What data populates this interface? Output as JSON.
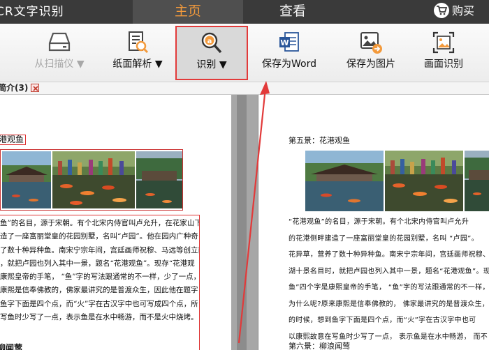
{
  "header": {
    "app_title": "CR文字识别",
    "tabs": [
      {
        "label": "主页",
        "active": true
      },
      {
        "label": "查看",
        "active": false
      }
    ],
    "buy_label": "购买",
    "accent_color": "#f39a3c"
  },
  "toolbar": {
    "scan": {
      "label": "从扫描仪 ▼",
      "icon": "scanner-icon",
      "enabled": false
    },
    "paper_analysis": {
      "label": "纸面解析 ▼",
      "icon": "document-magnify-icon"
    },
    "recognize": {
      "label": "识别 ▼",
      "icon": "ocr-magnifier-icon",
      "highlighted": true
    },
    "save_word": {
      "label": "保存为Word",
      "icon": "word-icon"
    },
    "save_image": {
      "label": "保存为图片",
      "icon": "image-export-icon"
    },
    "page_recognize": {
      "label": "画面识别",
      "icon": "screen-capture-icon"
    }
  },
  "document_tab": {
    "label": "简介(3)"
  },
  "left_page": {
    "section_title": "港观鱼",
    "lines": [
      "鱼”的名目，源于宋朝。有个北宋内侍官叫卢允升，在花家山下",
      "造了一座富丽堂皇的花园别墅，名叫“卢园”。他在园内广种奇",
      "了数十种异种鱼。南宋宁宗年间，宫廷画师祝穆、马远等创立西",
      "，就把卢园也列入其中一景，题名“花港观鱼”。现存“花港观",
      "康熙皇帝的手笔，  “鱼”字的写法跟通常的不一样，少了一点，",
      "康熙是信奉佛教的，佛家最讲究的是普渡众生，因此他在题字",
      "鱼字下面是四个点，而“火”字在古汉字中也可写成四个点，所",
      "写鱼时少写了一点，表示鱼是在水中畅游，而不是火中烧烤。"
    ],
    "next_section": "柳闻莺"
  },
  "right_page": {
    "section_title": "第五景：花港观鱼",
    "lines": [
      "“花港观鱼”的名目，源于宋朝。有个北宋内侍官叫卢允升",
      "的花港侧畔建造了一座富丽堂皇的花园别墅，名叫 “卢园”。",
      "花异草，营养了数十种异种鱼。南宋宁宗年间，宫廷画师祝穆、马",
      "湖十景名目时，就把卢园也列入其中一景，题名“花港观鱼”。现",
      "鱼”四个字是康熙皇帝的手笔，     “鱼”字的写法跟通常的不一样，",
      "为什么呢?原来康熙是信奉佛教的，   佛家最讲究的是普渡众生，",
      "的时候，想到鱼字下面是四个点，而“火”字在古汉字中也可",
      "以康熙故意在写鱼时少写了一点，    表示鱼是在水中畅游，    而不"
    ],
    "next_section": "第六景：柳浪闻莺"
  }
}
